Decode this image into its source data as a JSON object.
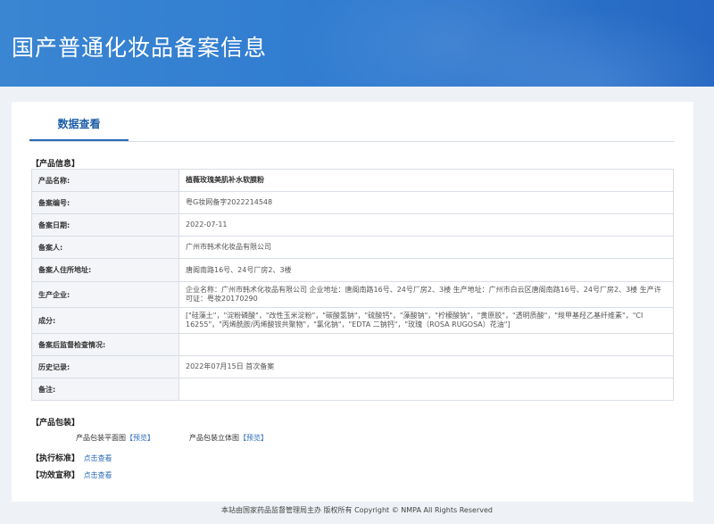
{
  "header": {
    "title": "国产普通化妆品备案信息"
  },
  "tabs": [
    {
      "label": "数据查看"
    }
  ],
  "sections": {
    "product_info": "【产品信息】",
    "product_package": "【产品包装】",
    "standard": "【执行标准】",
    "efficacy": "【功效宣称】"
  },
  "info_rows": [
    {
      "label": "产品名称:",
      "value": "植薇玫瑰美肌补水软膜粉"
    },
    {
      "label": "备案编号:",
      "value": "粤G妆网备字2022214548"
    },
    {
      "label": "备案日期:",
      "value": "2022-07-11"
    },
    {
      "label": "备案人:",
      "value": "广州市韩术化妆品有限公司"
    },
    {
      "label": "备案人住所地址:",
      "value": "唐阁南路16号、24号厂房2、3楼"
    },
    {
      "label": "生产企业:",
      "value": "企业名称：广州市韩术化妆品有限公司 企业地址：唐阁南路16号、24号厂房2、3楼 生产地址：广州市白云区唐阁南路16号、24号厂房2、3楼 生产许可证：粤妆20170290"
    },
    {
      "label": "成分:",
      "value": "[\"硅藻土\"，\"淀粉磷酸\"，\"改性玉米淀粉\"，\"碳酸氢钠\"，\"硫酸钙\"，\"藻酸钠\"，\"柠檬酸钠\"，\"黄原胶\"，\"透明质酸\"，\"羧甲基羟乙基纤维素\"，\"CI 16255\"，\"丙烯酰胺/丙烯酸铵共聚物\"，\"氯化钠\"，\"EDTA 二钠钙\"，\"玫瑰（ROSA RUGOSA）花油\"]"
    },
    {
      "label": "备案后监督检查情况:",
      "value": ""
    },
    {
      "label": "历史记录:",
      "value": "2022年07月15日 首次备案"
    },
    {
      "label": "备注:",
      "value": ""
    }
  ],
  "package": {
    "flat_label": "产品包装平面图",
    "flat_link": "预览",
    "solid_label": "产品包装立体图",
    "solid_link": "预览",
    "bracket_open": "【",
    "bracket_close": "】"
  },
  "standard_link": "点击查看",
  "efficacy_link": "点击查看",
  "footer": {
    "text": "本站由国家药品监督管理局主办 版权所有 Copyright © NMPA All Rights Reserved"
  }
}
